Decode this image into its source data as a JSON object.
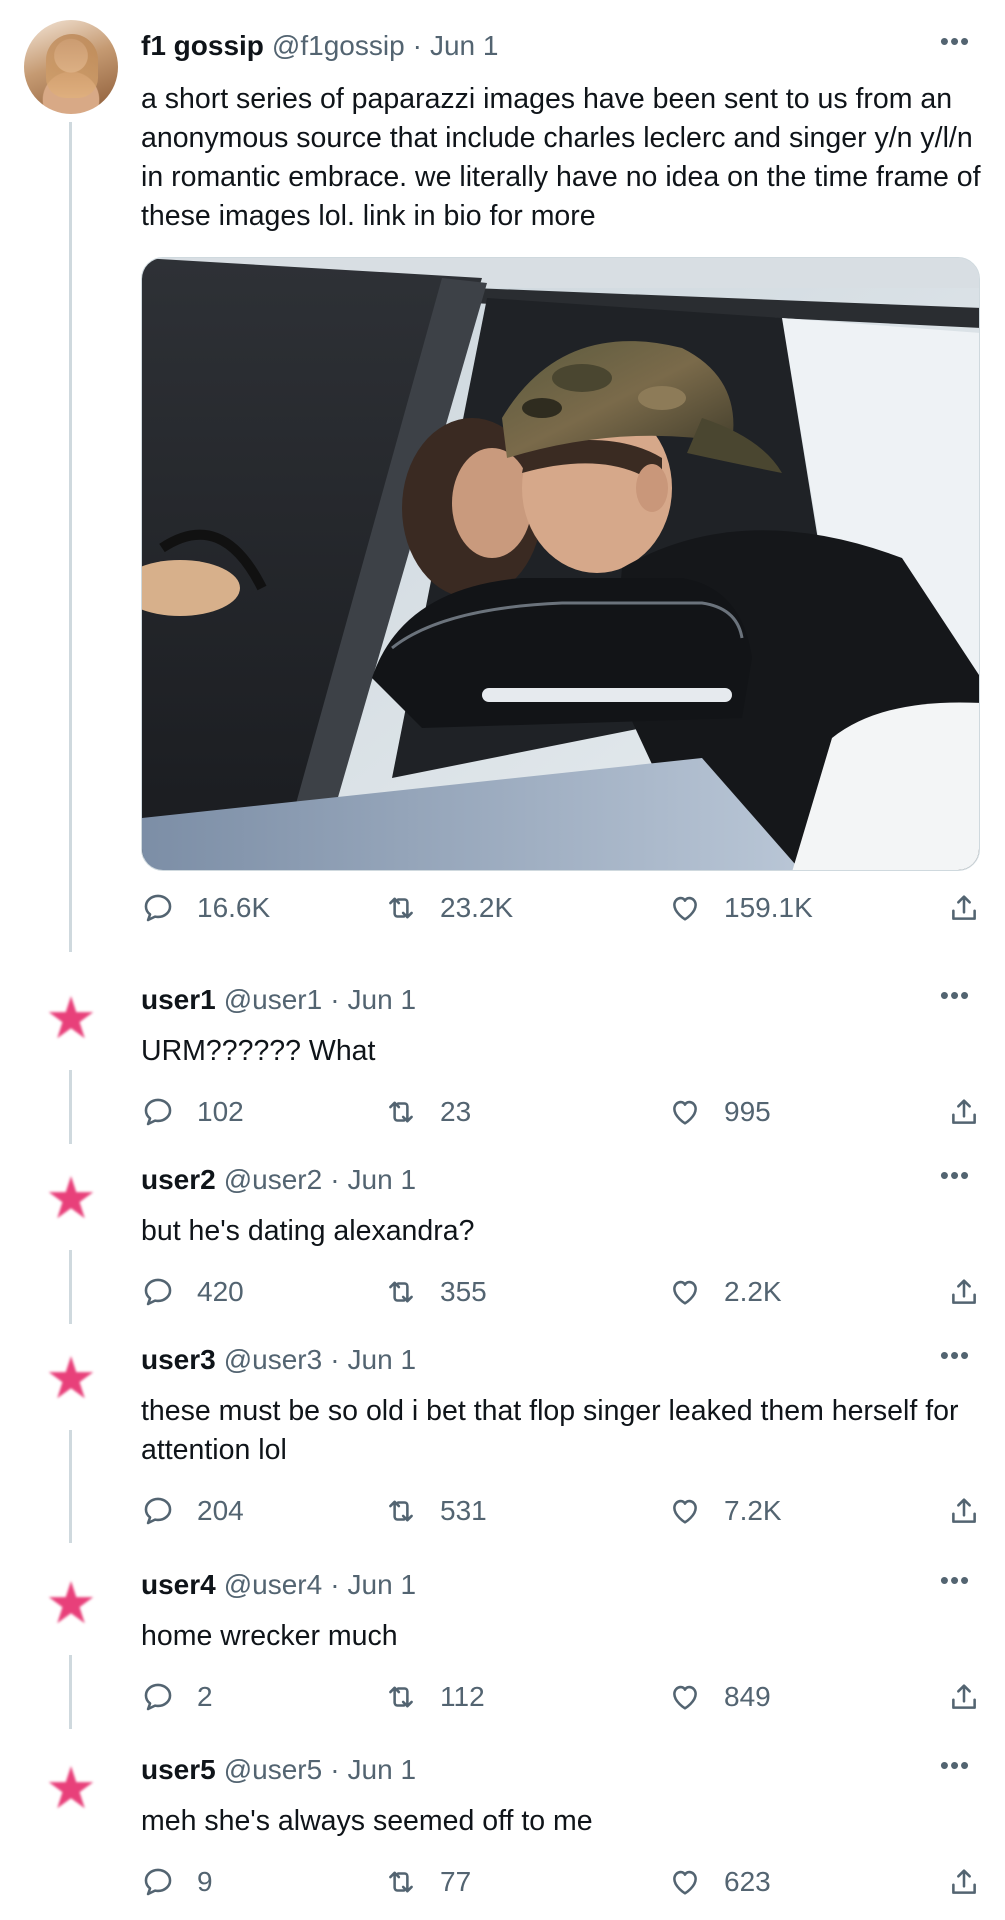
{
  "main_tweet": {
    "display_name": "f1 gossip",
    "handle": "@f1gossip",
    "date": "Jun 1",
    "text": "a short series of paparazzi images have been sent to us from an anonymous source that include charles leclerc and singer y/n y/l/n in romantic embrace. we literally have no idea on the time frame of these images lol. link in bio for more",
    "replies": "16.6K",
    "retweets": "23.2K",
    "likes": "159.1K",
    "more_icon": "more-horizontal-icon"
  },
  "replies": [
    {
      "display_name": "user1",
      "handle": "@user1",
      "date": "Jun 1",
      "text": "URM?????? What",
      "replies": "102",
      "retweets": "23",
      "likes": "995"
    },
    {
      "display_name": "user2",
      "handle": "@user2",
      "date": "Jun 1",
      "text": "but he's dating alexandra?",
      "replies": "420",
      "retweets": "355",
      "likes": "2.2K"
    },
    {
      "display_name": "user3",
      "handle": "@user3",
      "date": "Jun 1",
      "text": "these must be so old i bet that flop singer leaked them herself for attention lol",
      "replies": "204",
      "retweets": "531",
      "likes": "7.2K"
    },
    {
      "display_name": "user4",
      "handle": "@user4",
      "date": "Jun 1",
      "text": "home wrecker much",
      "replies": "2",
      "retweets": "112",
      "likes": "849"
    },
    {
      "display_name": "user5",
      "handle": "@user5",
      "date": "Jun 1",
      "text": "meh she's always seemed off to me",
      "replies": "9",
      "retweets": "77",
      "likes": "623"
    }
  ],
  "colors": {
    "text": "#0f1419",
    "secondary": "#536471",
    "thread_line": "#cfd9de",
    "star": "#e8407a"
  },
  "icons": [
    "reply-icon",
    "retweet-icon",
    "like-icon",
    "share-icon",
    "star-icon",
    "more-horizontal-icon"
  ]
}
